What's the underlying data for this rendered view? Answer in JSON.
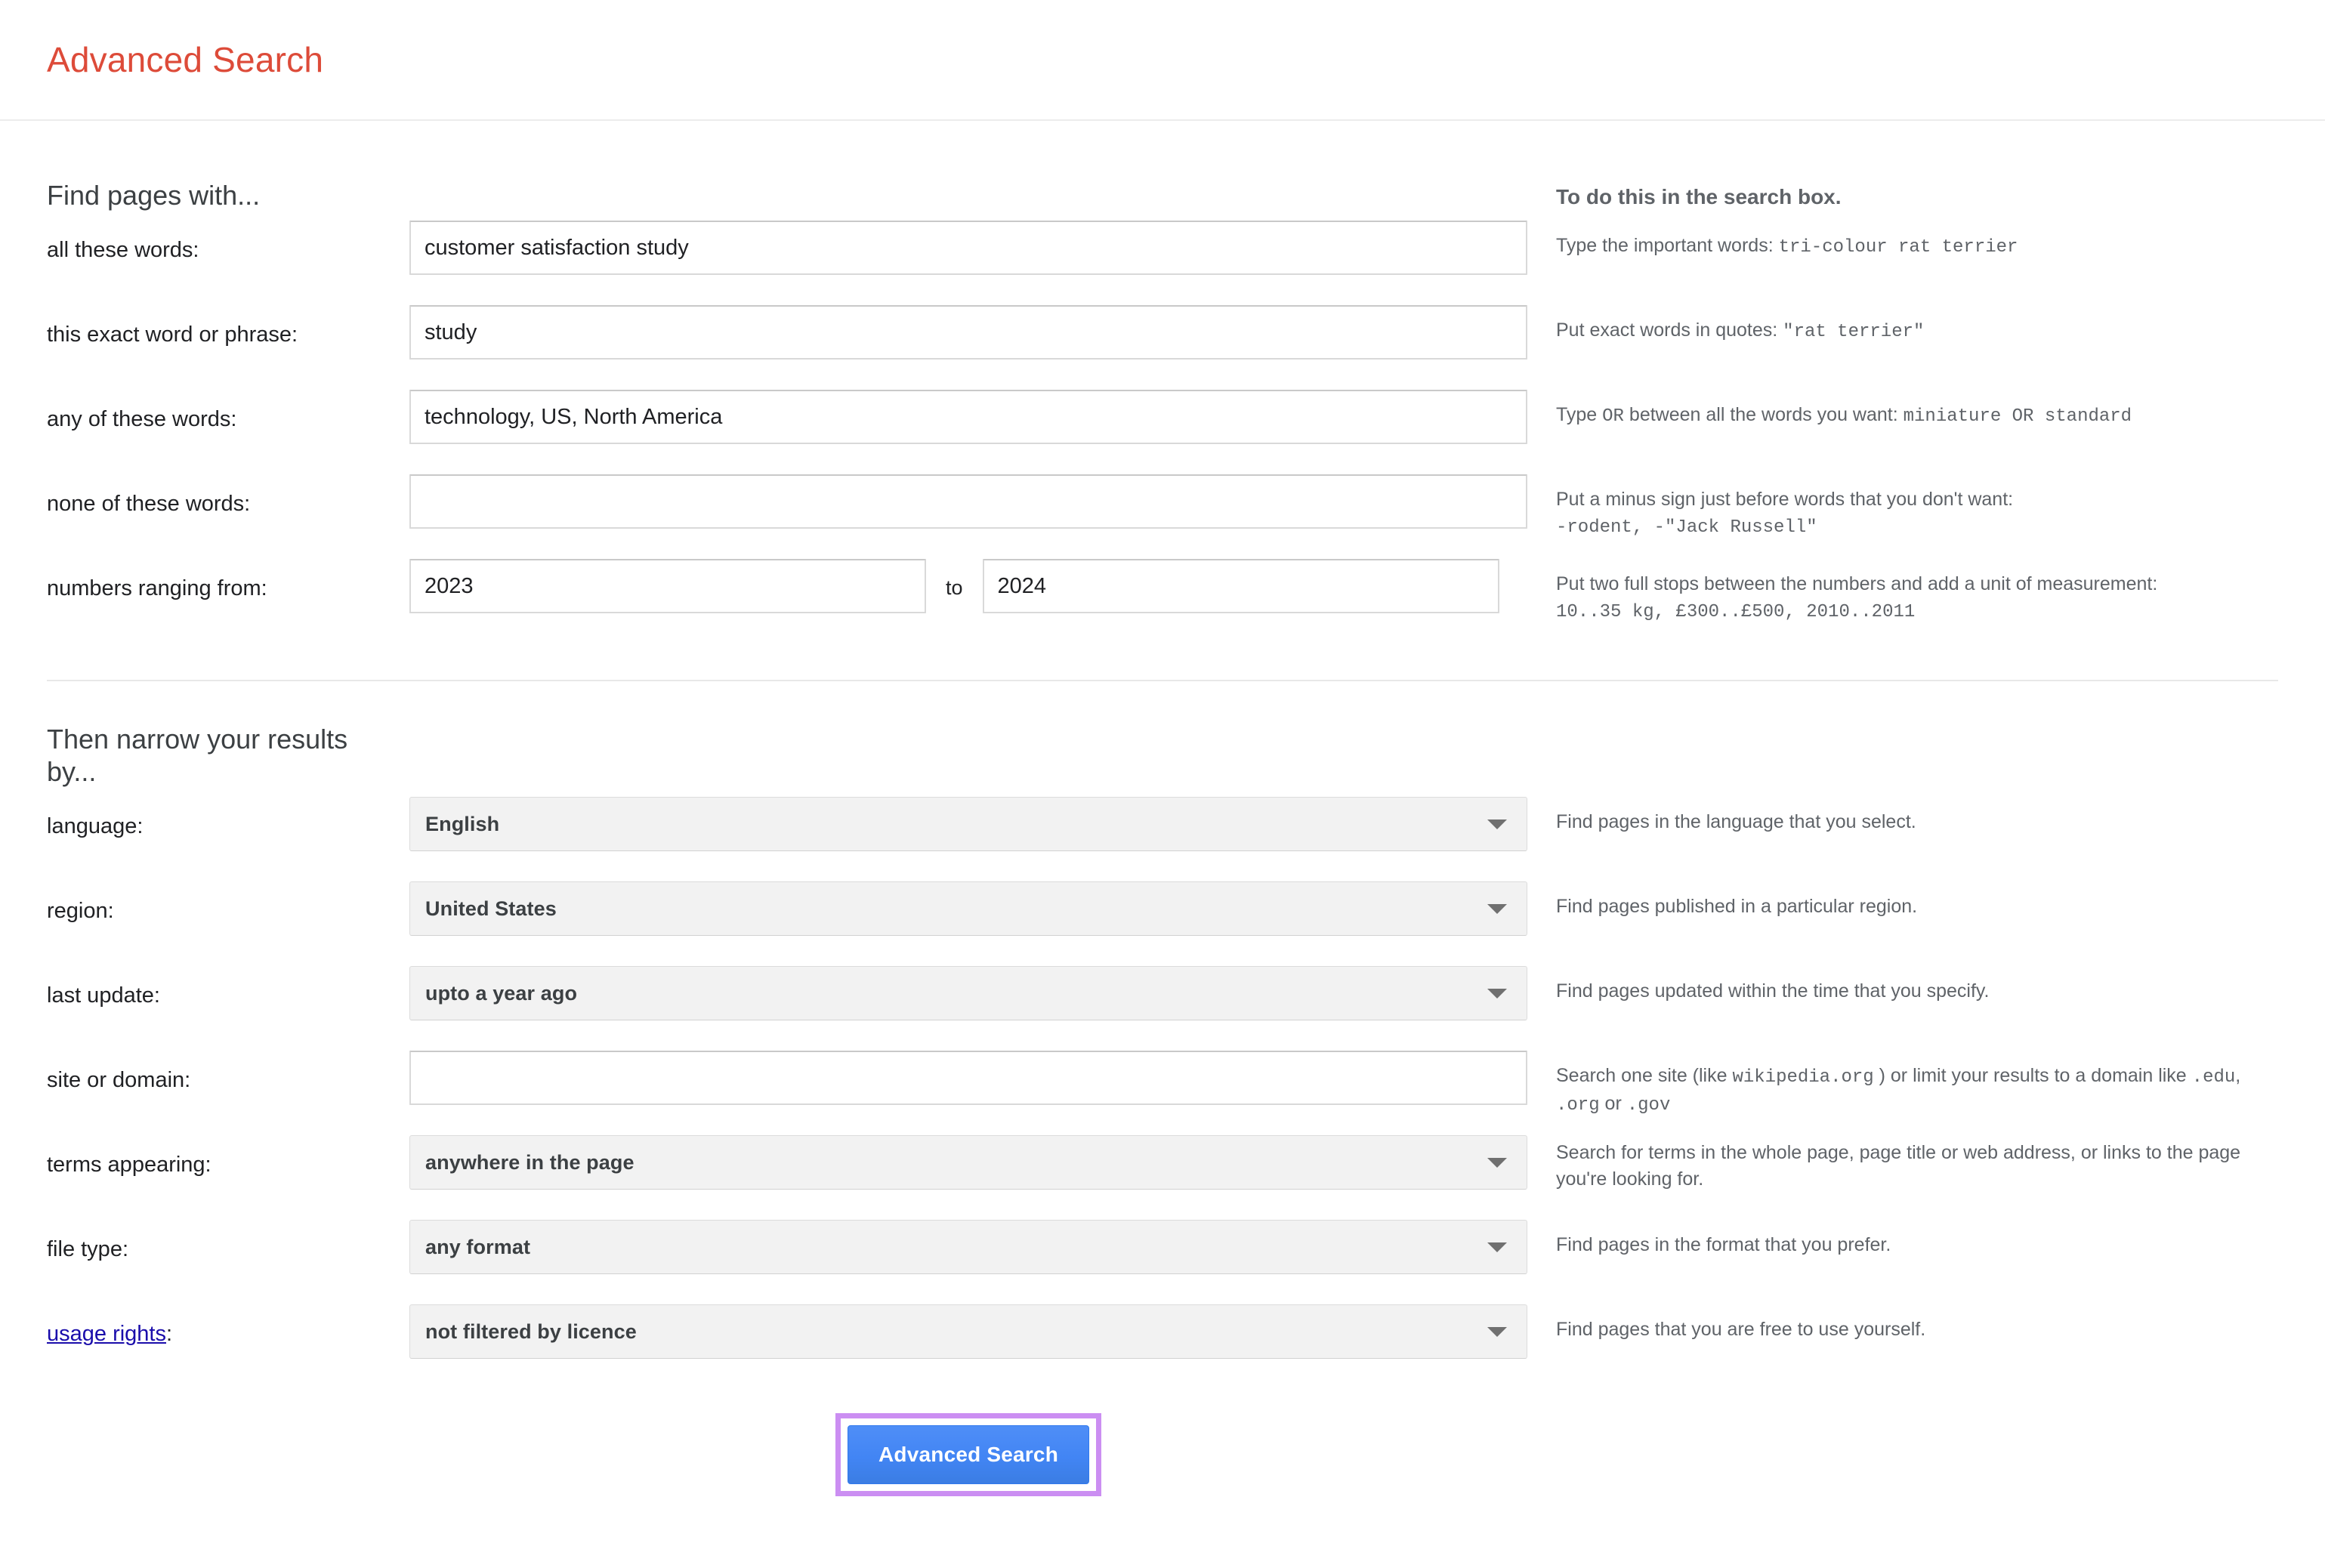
{
  "header": {
    "title": "Advanced Search"
  },
  "find_section": {
    "heading": "Find pages with...",
    "hint_heading": "To do this in the search box.",
    "rows": [
      {
        "label": "all these words:",
        "value": "customer satisfaction study",
        "placeholder": "",
        "hint_prefix": "Type the important words: ",
        "hint_mono": "tri-colour rat terrier",
        "hint_suffix": ""
      },
      {
        "label": "this exact word or phrase:",
        "value": "study",
        "placeholder": "",
        "hint_prefix": "Put exact words in quotes: ",
        "hint_mono": "\"rat terrier\"",
        "hint_suffix": ""
      },
      {
        "label": "any of these words:",
        "value": "technology, US, North America",
        "placeholder": "",
        "hint_prefix": "Type ",
        "hint_mono": "OR",
        "hint_mid": " between all the words you want: ",
        "hint_mono2": "miniature OR standard",
        "hint_suffix": ""
      },
      {
        "label": "none of these words:",
        "value": "",
        "placeholder": "",
        "hint_prefix": "Put a minus sign just before words that you don't want:",
        "hint_mono": "-rodent, -\"Jack Russell\"",
        "hint_suffix": ""
      }
    ],
    "range_row": {
      "label": "numbers ranging from:",
      "from_value": "2023",
      "to_value": "2024",
      "separator": "to",
      "from_placeholder": "",
      "to_placeholder": "",
      "hint_prefix": "Put two full stops between the numbers and add a unit of measurement:",
      "hint_mono": "10..35 kg, £300..£500, 2010..2011"
    }
  },
  "narrow_section": {
    "heading": "Then narrow your results by...",
    "rows": [
      {
        "label": "language:",
        "type": "select",
        "value": "English",
        "hint": "Find pages in the language that you select."
      },
      {
        "label": "region:",
        "type": "select",
        "value": "United States",
        "hint": "Find pages published in a particular region."
      },
      {
        "label": "last update:",
        "type": "select",
        "value": "upto a year ago",
        "hint": "Find pages updated within the time that you specify."
      },
      {
        "label": "site or domain:",
        "type": "text",
        "value": "",
        "placeholder": "",
        "hint_a": "Search one site (like ",
        "hint_mono_a": "wikipedia.org",
        "hint_b": " ) or limit your results to a domain like ",
        "hint_mono_b": ".edu",
        "hint_c": ", ",
        "hint_mono_c": ".org",
        "hint_d": " or ",
        "hint_mono_d": ".gov"
      },
      {
        "label": "terms appearing:",
        "type": "select",
        "value": "anywhere in the page",
        "hint": "Search for terms in the whole page, page title or web address, or links to the page you're looking for."
      },
      {
        "label": "file type:",
        "type": "select",
        "value": "any format",
        "hint": "Find pages in the format that you prefer."
      },
      {
        "label": "usage rights:",
        "label_link_text": "usage rights",
        "label_suffix": ":",
        "type": "select",
        "value": "not filtered by licence",
        "hint": "Find pages that you are free to use yourself."
      }
    ]
  },
  "submit": {
    "label": "Advanced Search"
  },
  "icons": {
    "caret": "chevron-down-icon"
  },
  "colors": {
    "title": "#dd4b39",
    "link": "#1a0dab",
    "button": "#4285f4",
    "highlight": "#cb8ef2",
    "select_bg": "#f2f2f2"
  }
}
